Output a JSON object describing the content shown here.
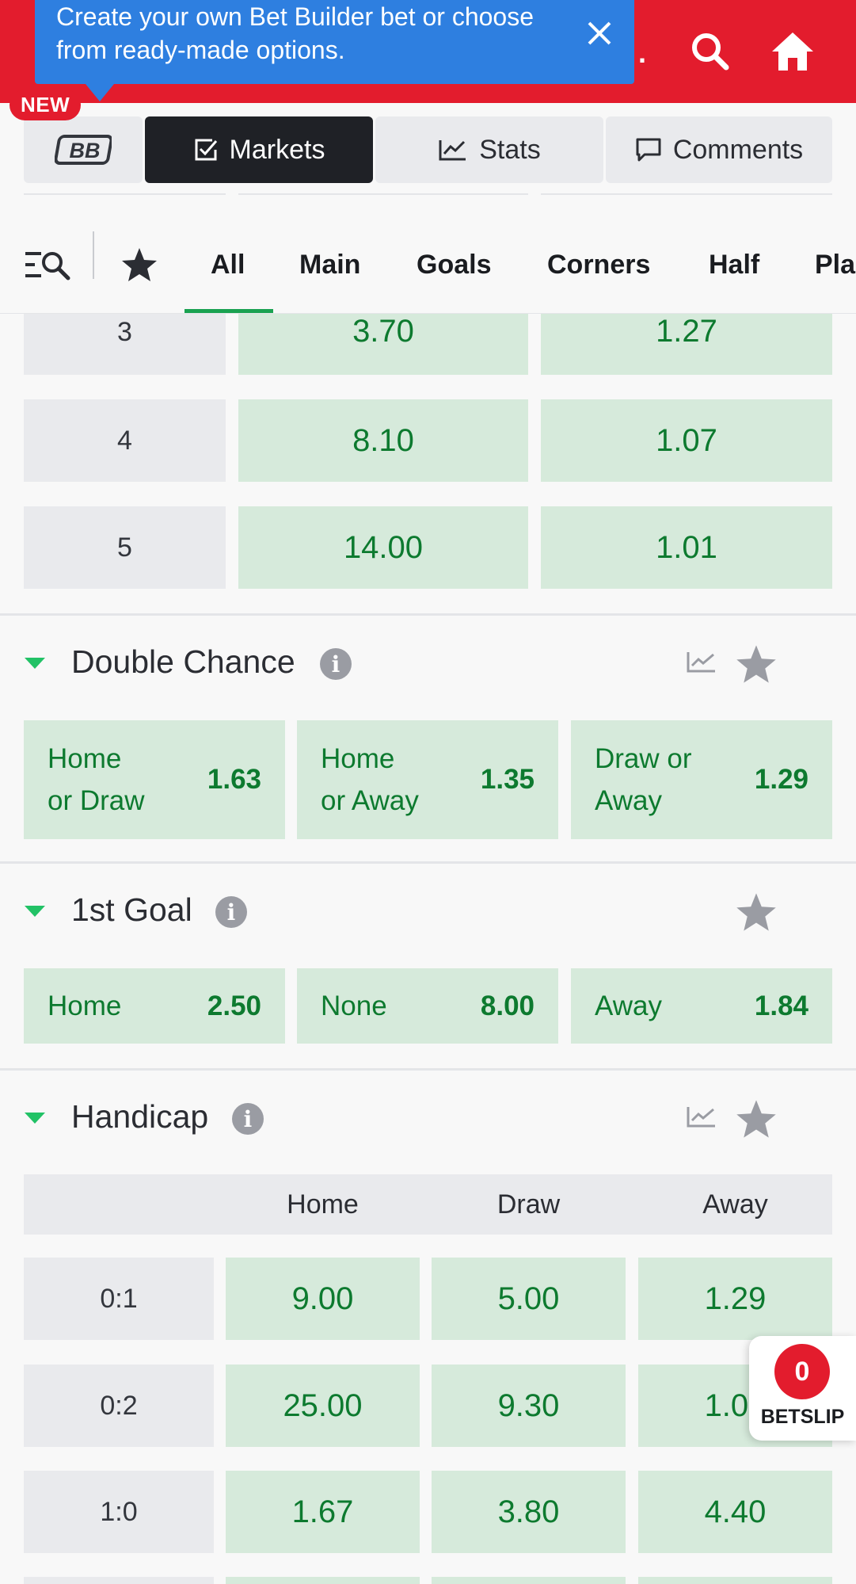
{
  "colors": {
    "brand_red": "#e31c2d",
    "tooltip_blue": "#2e7fe0",
    "odds_green": "#0d7a2f",
    "odds_bg": "#d6eadb",
    "active_tab": "#1f2126",
    "accent_green": "#1aa251"
  },
  "header": {
    "dot": ".",
    "search_icon": "search-icon",
    "home_icon": "home-icon"
  },
  "tooltip": {
    "text": "Create your own Bet Builder bet or choose from ready-made options.",
    "close_icon": "close-icon"
  },
  "new_badge": "NEW",
  "tabs": [
    {
      "label": "BB",
      "icon": "bet-builder-logo"
    },
    {
      "label": "Markets",
      "icon": "checkbox-icon",
      "active": true
    },
    {
      "label": "Stats",
      "icon": "chart-icon"
    },
    {
      "label": "Comments",
      "icon": "comment-icon"
    }
  ],
  "filters": {
    "search_icon": "filter-search-icon",
    "star_icon": "star-icon",
    "items": [
      "All",
      "Main",
      "Goals",
      "Corners",
      "Half",
      "Pla"
    ],
    "active": "All"
  },
  "goals_rows": [
    {
      "label": "3",
      "over": "3.70",
      "under": "1.27"
    },
    {
      "label": "4",
      "over": "8.10",
      "under": "1.07"
    },
    {
      "label": "5",
      "over": "14.00",
      "under": "1.01"
    }
  ],
  "double_chance": {
    "title": "Double Chance",
    "info": "i",
    "options": [
      {
        "line1": "Home",
        "line2": "or Draw",
        "odds": "1.63"
      },
      {
        "line1": "Home",
        "line2": "or Away",
        "odds": "1.35"
      },
      {
        "line1": "Draw or",
        "line2": "Away",
        "odds": "1.29"
      }
    ]
  },
  "first_goal": {
    "title": "1st Goal",
    "info": "i",
    "options": [
      {
        "label": "Home",
        "odds": "2.50"
      },
      {
        "label": "None",
        "odds": "8.00"
      },
      {
        "label": "Away",
        "odds": "1.84"
      }
    ]
  },
  "handicap": {
    "title": "Handicap",
    "info": "i",
    "columns": [
      "Home",
      "Draw",
      "Away"
    ],
    "rows": [
      {
        "label": "0:1",
        "home": "9.00",
        "draw": "5.00",
        "away": "1.29"
      },
      {
        "label": "0:2",
        "home": "25.00",
        "draw": "9.30",
        "away": "1.06"
      },
      {
        "label": "1:0",
        "home": "1.67",
        "draw": "3.80",
        "away": "4.40"
      }
    ]
  },
  "betslip": {
    "count": "0",
    "label": "BETSLIP"
  }
}
